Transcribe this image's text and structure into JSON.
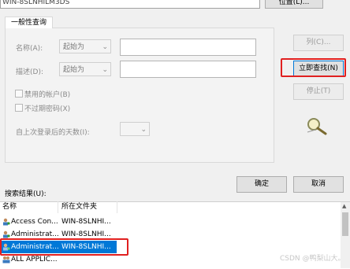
{
  "top": {
    "search_in_value": "WIN-8SLNHILM3DS",
    "location_button": "位置(L)..."
  },
  "tab_label": "一般性查询",
  "form": {
    "name_label": "名称(A):",
    "name_combo": "起始为",
    "desc_label": "描述(D):",
    "desc_combo": "起始为",
    "disabled_accounts": "禁用的帐户(B)",
    "non_expiring_pw": "不过期密码(X)",
    "days_since_logon": "自上次登录后的天数(I):"
  },
  "buttons": {
    "columns": "列(C)...",
    "find_now": "立即查找(N)",
    "stop": "停止(T)",
    "ok": "确定",
    "cancel": "取消"
  },
  "results": {
    "label": "搜索结果(U):",
    "col_name": "名称",
    "col_folder": "所在文件夹",
    "rows": [
      {
        "name": "Access Con...",
        "folder": "WIN-8SLNHI..."
      },
      {
        "name": "Administrat...",
        "folder": "WIN-8SLNHI..."
      },
      {
        "name": "Administrat...",
        "folder": "WIN-8SLNHI..."
      },
      {
        "name": "ALL APPLIC...",
        "folder": ""
      }
    ],
    "selected_index": 2
  },
  "watermark": "CSDN @鸭梨山大。",
  "colors": {
    "selection": "#0078d7",
    "highlight_box": "#e02020"
  }
}
